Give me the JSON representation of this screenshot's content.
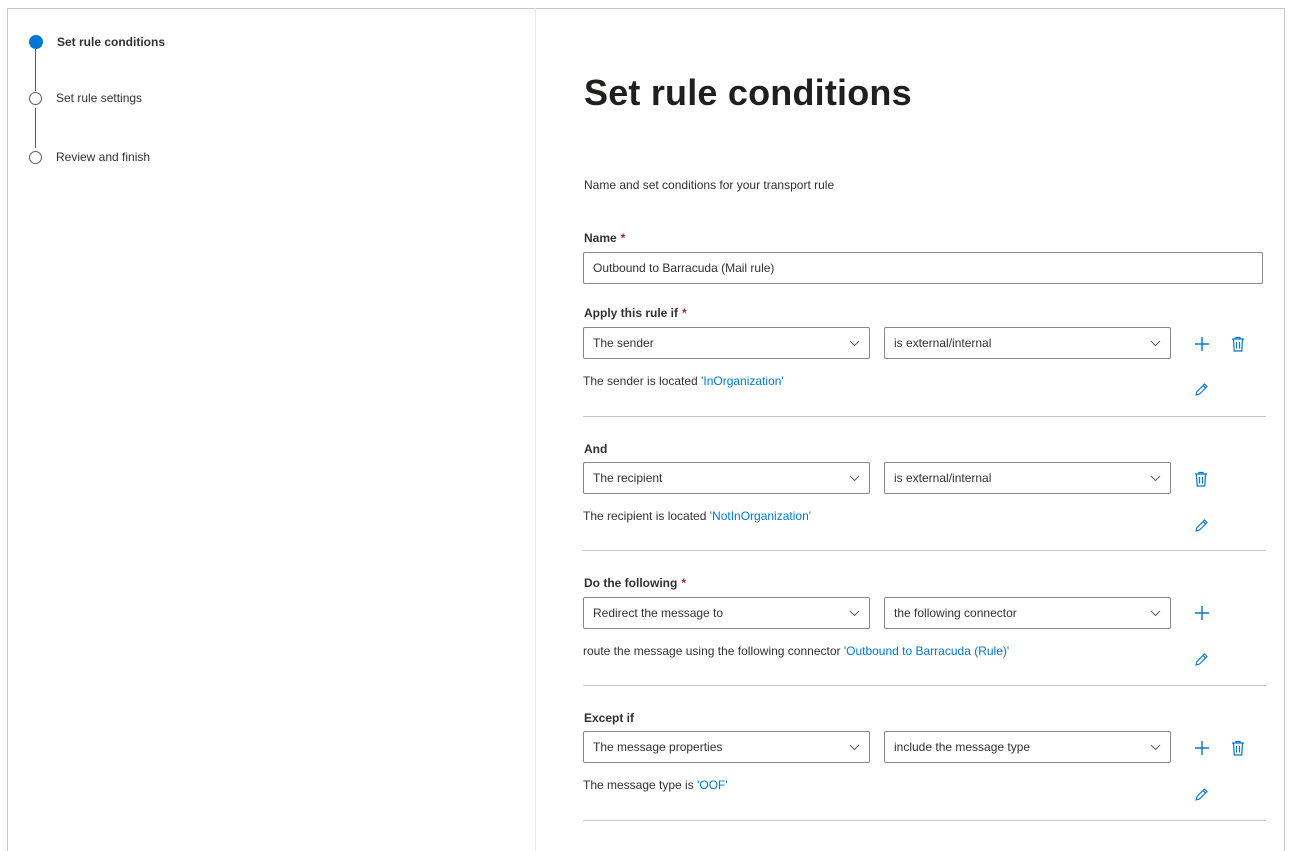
{
  "wizard": {
    "steps": [
      {
        "label": "Set rule conditions",
        "state": "current"
      },
      {
        "label": "Set rule settings",
        "state": "pending"
      },
      {
        "label": "Review and finish",
        "state": "pending"
      }
    ]
  },
  "page": {
    "title": "Set rule conditions",
    "subtitle": "Name and set conditions for your transport rule"
  },
  "name_field": {
    "label": "Name",
    "required_mark": "*",
    "value": "Outbound to Barracuda (Mail rule)"
  },
  "sections": [
    {
      "label": "Apply this rule if",
      "required_mark": "*",
      "dropdown1": "The sender",
      "dropdown2": "is external/internal",
      "desc_prefix": "The sender is located ",
      "desc_link": "'InOrganization'"
    },
    {
      "label": "And",
      "required_mark": "",
      "dropdown1": "The recipient",
      "dropdown2": "is external/internal",
      "desc_prefix": "The recipient is located ",
      "desc_link": "'NotInOrganization'"
    },
    {
      "label": "Do the following",
      "required_mark": "*",
      "dropdown1": "Redirect the message to",
      "dropdown2": "the following connector",
      "desc_prefix": "route the message using the following connector ",
      "desc_link": "'Outbound to Barracuda (Rule)'"
    },
    {
      "label": "Except if",
      "required_mark": "",
      "dropdown1": "The message properties",
      "dropdown2": "include the message type",
      "desc_prefix": "The message type is ",
      "desc_link": "'OOF'"
    }
  ],
  "icons": {
    "add": "plus-icon",
    "delete": "trash-icon",
    "edit": "pencil-icon",
    "dropdown": "chevron-down-icon"
  },
  "colors": {
    "accent": "#0078d4",
    "required": "#a4262c",
    "border": "#8a8886",
    "divider": "#c8c6c4"
  }
}
